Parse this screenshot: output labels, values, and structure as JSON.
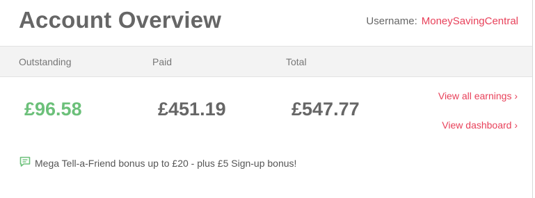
{
  "header": {
    "title": "Account Overview",
    "username_label": "Username:",
    "username_value": "MoneySavingCentral"
  },
  "columns": {
    "outstanding": "Outstanding",
    "paid": "Paid",
    "total": "Total"
  },
  "amounts": {
    "outstanding": "£96.58",
    "paid": "£451.19",
    "total": "£547.77"
  },
  "links": {
    "view_all_earnings": "View all earnings ›",
    "view_dashboard": "View dashboard ›"
  },
  "promo": {
    "icon": "speech-bubble-icon",
    "text": "Mega Tell-a-Friend bonus up to £20 - plus £5 Sign-up bonus!"
  },
  "colors": {
    "accent": "#e8415a",
    "positive": "#6cc07a",
    "text": "#666666"
  }
}
